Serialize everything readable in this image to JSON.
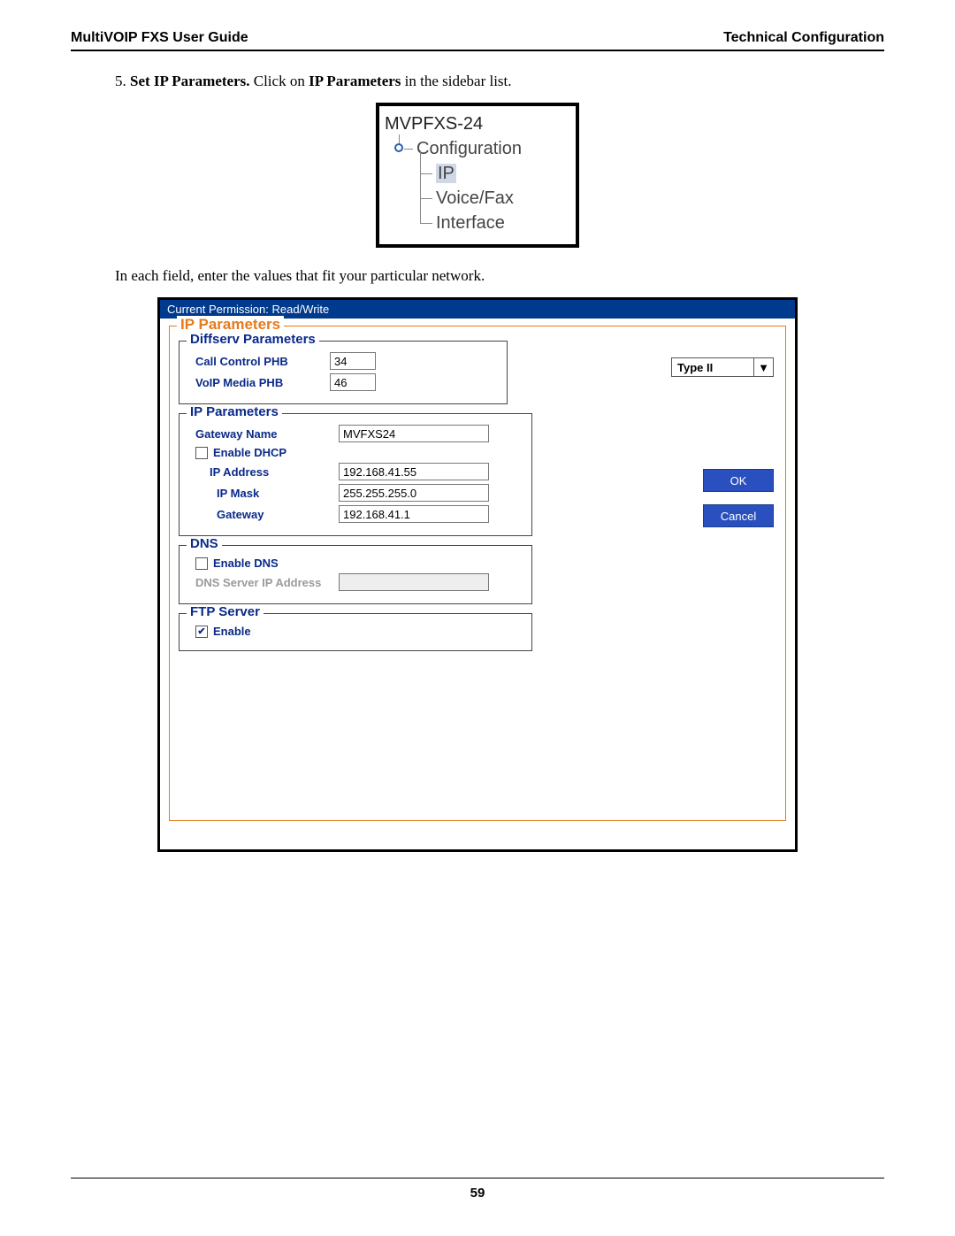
{
  "header": {
    "left": "MultiVOIP FXS User Guide",
    "right": "Technical Configuration"
  },
  "step": {
    "num": "5.",
    "title": "Set IP Parameters.",
    "rest1": "  Click on ",
    "bold2": "IP Parameters",
    "rest2": " in the sidebar list."
  },
  "tree": {
    "root": "MVPFXS-24",
    "l1": "Configuration",
    "items": [
      "IP",
      "Voice/Fax",
      "Interface"
    ]
  },
  "mid_text": "In each field, enter the values that fit  your particular network.",
  "panel": {
    "titlebar": "Current Permission:  Read/Write",
    "main_legend": "IP Parameters",
    "type_value": "Type II",
    "diffserv": {
      "legend": "Diffserv Parameters",
      "call_label": "Call Control PHB",
      "call_value": "34",
      "media_label": "VoIP Media PHB",
      "media_value": "46"
    },
    "ip": {
      "legend": "IP Parameters",
      "gwname_label": "Gateway Name",
      "gwname_value": "MVFXS24",
      "dhcp_label": "Enable DHCP",
      "ipaddr_label": "IP Address",
      "ipaddr_value": "192.168.41.55",
      "mask_label": "IP Mask",
      "mask_value": "255.255.255.0",
      "gw_label": "Gateway",
      "gw_value": "192.168.41.1"
    },
    "dns": {
      "legend": "DNS",
      "enable_label": "Enable DNS",
      "server_label": "DNS Server IP Address"
    },
    "ftp": {
      "legend": "FTP Server",
      "enable_label": "Enable"
    },
    "ok": "OK",
    "cancel": "Cancel"
  },
  "page_number": "59"
}
